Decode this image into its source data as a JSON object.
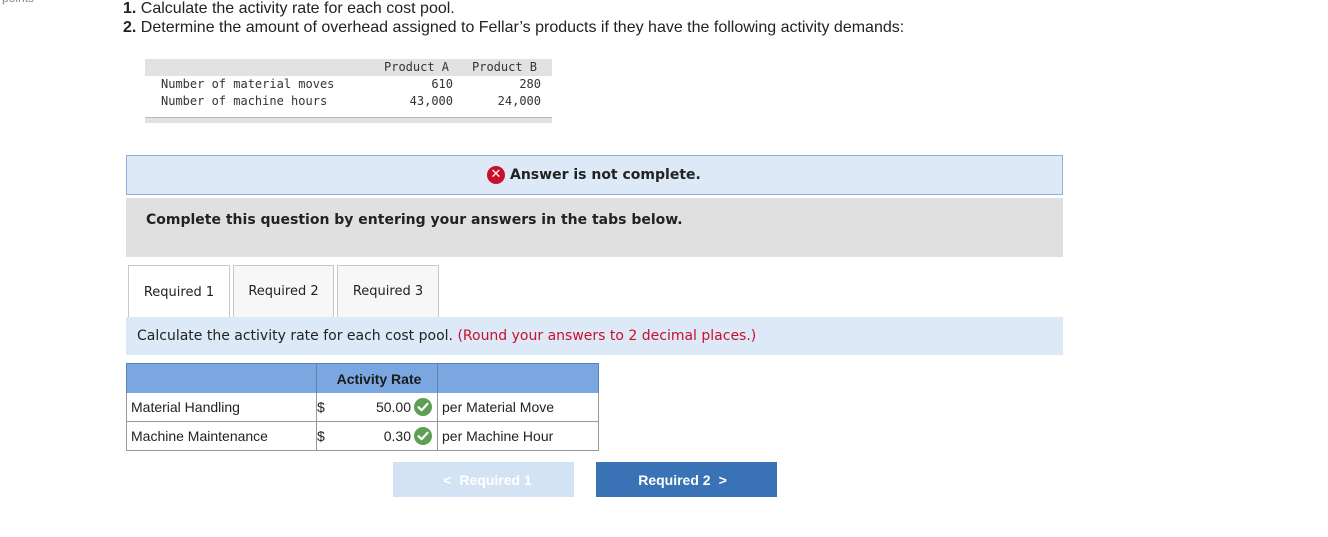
{
  "corner": {
    "text": "points"
  },
  "question": {
    "line1_num": "1.",
    "line1_text": "Calculate the activity rate for each cost pool.",
    "line2_num": "2.",
    "line2_text": "Determine the amount of overhead assigned to Fellar’s products if they have the following activity demands:"
  },
  "demand_table": {
    "headers": [
      "Product A",
      "Product B"
    ],
    "rows": [
      {
        "label": "Number of material moves",
        "a": "610",
        "b": "280"
      },
      {
        "label": "Number of machine hours",
        "a": "43,000",
        "b": "24,000"
      }
    ]
  },
  "banner": {
    "icon": "x-circle-icon",
    "text": "Answer is not complete."
  },
  "instruction": {
    "text": "Complete this question by entering your answers in the tabs below."
  },
  "tabs": [
    {
      "label": "Required 1",
      "active": true
    },
    {
      "label": "Required 2",
      "active": false
    },
    {
      "label": "Required 3",
      "active": false
    }
  ],
  "sub_instruction": {
    "text": "Calculate the activity rate for each cost pool.",
    "note": "(Round your answers to 2 decimal places.)"
  },
  "answer_table": {
    "header": "Activity Rate",
    "rows": [
      {
        "name": "Material Handling",
        "currency": "$",
        "value": "50.00",
        "unit": "per Material Move",
        "status": "correct"
      },
      {
        "name": "Machine Maintenance",
        "currency": "$",
        "value": "0.30",
        "unit": "per Machine Hour",
        "status": "correct"
      }
    ]
  },
  "nav": {
    "prev_label": "Required 1",
    "next_label": "Required 2"
  },
  "colors": {
    "accent": "#3a72b6",
    "error": "#c8102e",
    "success": "#5e9e55",
    "header_blue": "#7ba7e0"
  }
}
